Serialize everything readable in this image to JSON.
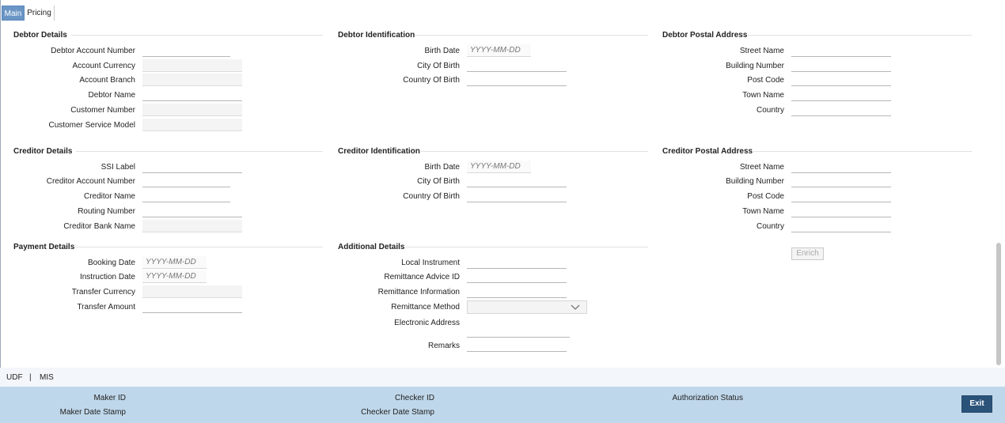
{
  "tabs": {
    "main": "Main",
    "pricing": "Pricing"
  },
  "debtor_details": {
    "title": "Debtor Details",
    "account_number": "Debtor Account Number",
    "account_currency": "Account Currency",
    "account_branch": "Account Branch",
    "debtor_name": "Debtor Name",
    "customer_number": "Customer Number",
    "customer_service_model": "Customer Service Model"
  },
  "debtor_identification": {
    "title": "Debtor Identification",
    "birth_date": "Birth Date",
    "birth_date_placeholder": "YYYY-MM-DD",
    "city_of_birth": "City Of Birth",
    "country_of_birth": "Country Of Birth"
  },
  "debtor_postal_address": {
    "title": "Debtor Postal Address",
    "street_name": "Street Name",
    "building_number": "Building Number",
    "post_code": "Post Code",
    "town_name": "Town Name",
    "country": "Country"
  },
  "creditor_details": {
    "title": "Creditor Details",
    "ssi_label": "SSI Label",
    "account_number": "Creditor Account Number",
    "creditor_name": "Creditor Name",
    "routing_number": "Routing Number",
    "bank_name": "Creditor Bank Name"
  },
  "creditor_identification": {
    "title": "Creditor Identification",
    "birth_date": "Birth Date",
    "birth_date_placeholder": "YYYY-MM-DD",
    "city_of_birth": "City Of Birth",
    "country_of_birth": "Country Of Birth"
  },
  "creditor_postal_address": {
    "title": "Creditor Postal Address",
    "street_name": "Street Name",
    "building_number": "Building Number",
    "post_code": "Post Code",
    "town_name": "Town Name",
    "country": "Country"
  },
  "payment_details": {
    "title": "Payment Details",
    "booking_date": "Booking Date",
    "booking_date_placeholder": "YYYY-MM-DD",
    "instruction_date": "Instruction Date",
    "instruction_date_placeholder": "YYYY-MM-DD",
    "transfer_currency": "Transfer Currency",
    "transfer_amount": "Transfer Amount"
  },
  "additional_details": {
    "title": "Additional Details",
    "local_instrument": "Local Instrument",
    "remittance_advice_id": "Remittance Advice ID",
    "remittance_information": "Remittance Information",
    "remittance_method": "Remittance Method",
    "electronic_address": "Electronic Address",
    "remarks": "Remarks"
  },
  "enrich_button": "Enrich",
  "bottom_links": {
    "udf": "UDF",
    "separator": "|",
    "mis": "MIS"
  },
  "footer": {
    "maker_id": "Maker ID",
    "maker_date_stamp": "Maker Date Stamp",
    "checker_id": "Checker ID",
    "checker_date_stamp": "Checker Date Stamp",
    "authorization_status": "Authorization Status",
    "exit": "Exit"
  },
  "colors": {
    "tab_active": "#6a95c5",
    "footer_bg": "#bfd7ea",
    "exit_button": "#2b5279"
  }
}
